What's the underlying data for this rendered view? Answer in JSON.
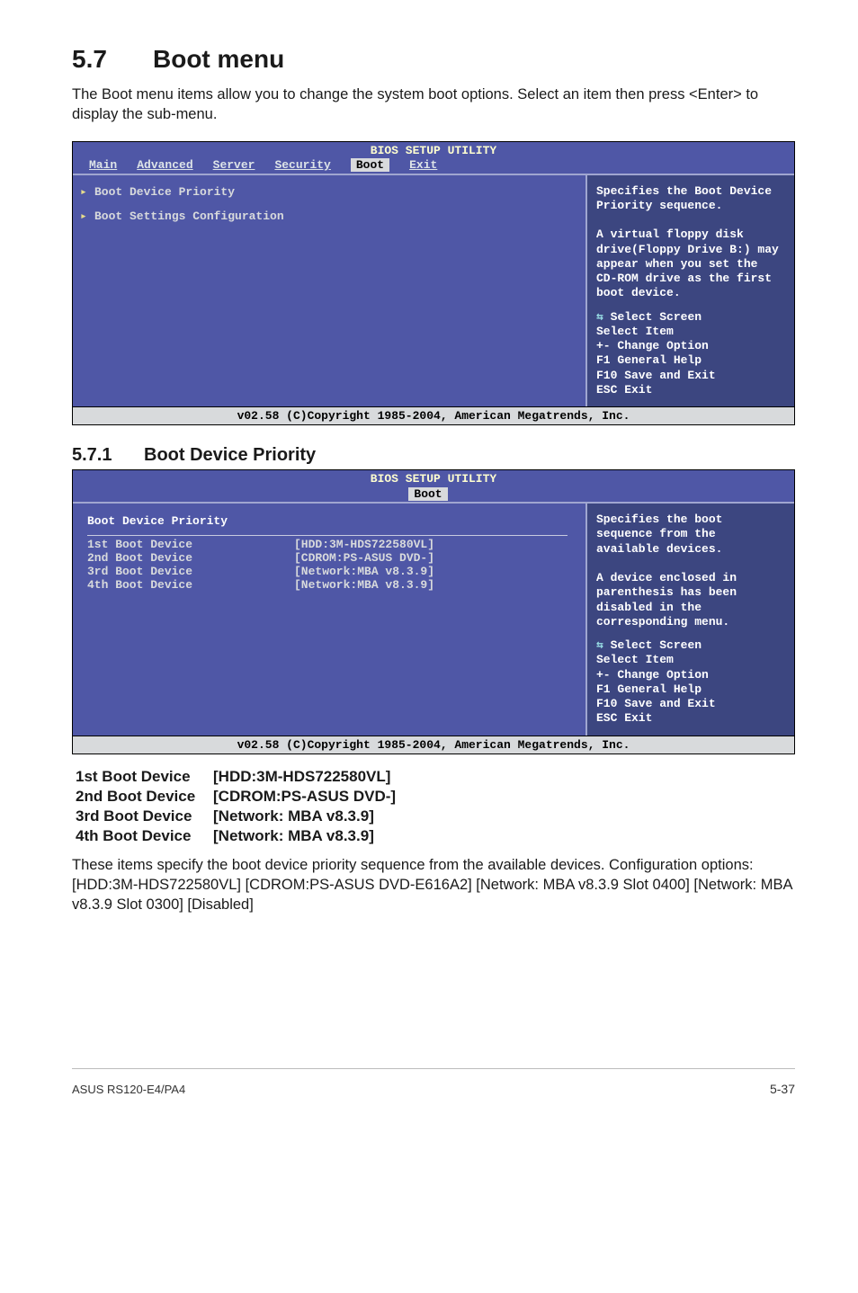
{
  "doc": {
    "h1_num": "5.7",
    "h1_title": "Boot menu",
    "intro": "The Boot menu items allow you to change the system boot options. Select an item then press <Enter> to display the sub-menu.",
    "h2_num": "5.7.1",
    "h2_title": "Boot Device Priority",
    "desc_p1": "These items specify the boot device priority sequence from the available devices. Configuration options: [HDD:3M-HDS722580VL] [CDROM:PS-ASUS DVD-E616A2] [Network: MBA v8.3.9 Slot 0400] [Network: MBA v8.3.9 Slot 0300] [Disabled]",
    "footer_left": "ASUS RS120-E4/PA4",
    "footer_right": "5-37"
  },
  "bios_common": {
    "title": "BIOS SETUP UTILITY",
    "footer": "v02.58 (C)Copyright 1985-2004, American Megatrends, Inc."
  },
  "bios1": {
    "menubar": {
      "items": [
        "Main",
        "Advanced",
        "Server",
        "Security"
      ],
      "active": "Boot",
      "after": [
        "Exit"
      ]
    },
    "main": {
      "items": [
        "Boot Device Priority",
        "Boot Settings Configuration"
      ]
    },
    "help": "Specifies the Boot Device Priority sequence.\n\nA virtual floppy disk drive(Floppy Drive B:) may appear when you set the CD-ROM drive as the first boot device.",
    "keys": "Select Screen\nSelect Item\n+-  Change Option\nF1  General Help\nF10 Save and Exit\nESC Exit"
  },
  "bios2": {
    "menubar": {
      "active": "Boot"
    },
    "group_title": "Boot Device Priority",
    "rows": [
      {
        "k": "1st Boot Device",
        "v": "[HDD:3M-HDS722580VL]"
      },
      {
        "k": "2nd Boot Device",
        "v": "[CDROM:PS-ASUS DVD-]"
      },
      {
        "k": "3rd Boot Device",
        "v": "[Network:MBA v8.3.9]"
      },
      {
        "k": "4th Boot Device",
        "v": "[Network:MBA v8.3.9]"
      }
    ],
    "help": "Specifies the boot sequence from the available devices.\n\nA device enclosed in parenthesis has been disabled in the corresponding menu.",
    "keys": "Select Screen\nSelect Item\n+-  Change Option\nF1  General Help\nF10 Save and Exit\nESC Exit"
  },
  "boot_lines": [
    {
      "k": "1st Boot Device",
      "v": "[HDD:3M-HDS722580VL]"
    },
    {
      "k": "2nd Boot Device",
      "v": "[CDROM:PS-ASUS DVD-]"
    },
    {
      "k": "3rd Boot Device",
      "v": "[Network: MBA v8.3.9]"
    },
    {
      "k": "4th Boot Device",
      "v": "[Network: MBA v8.3.9]"
    }
  ]
}
